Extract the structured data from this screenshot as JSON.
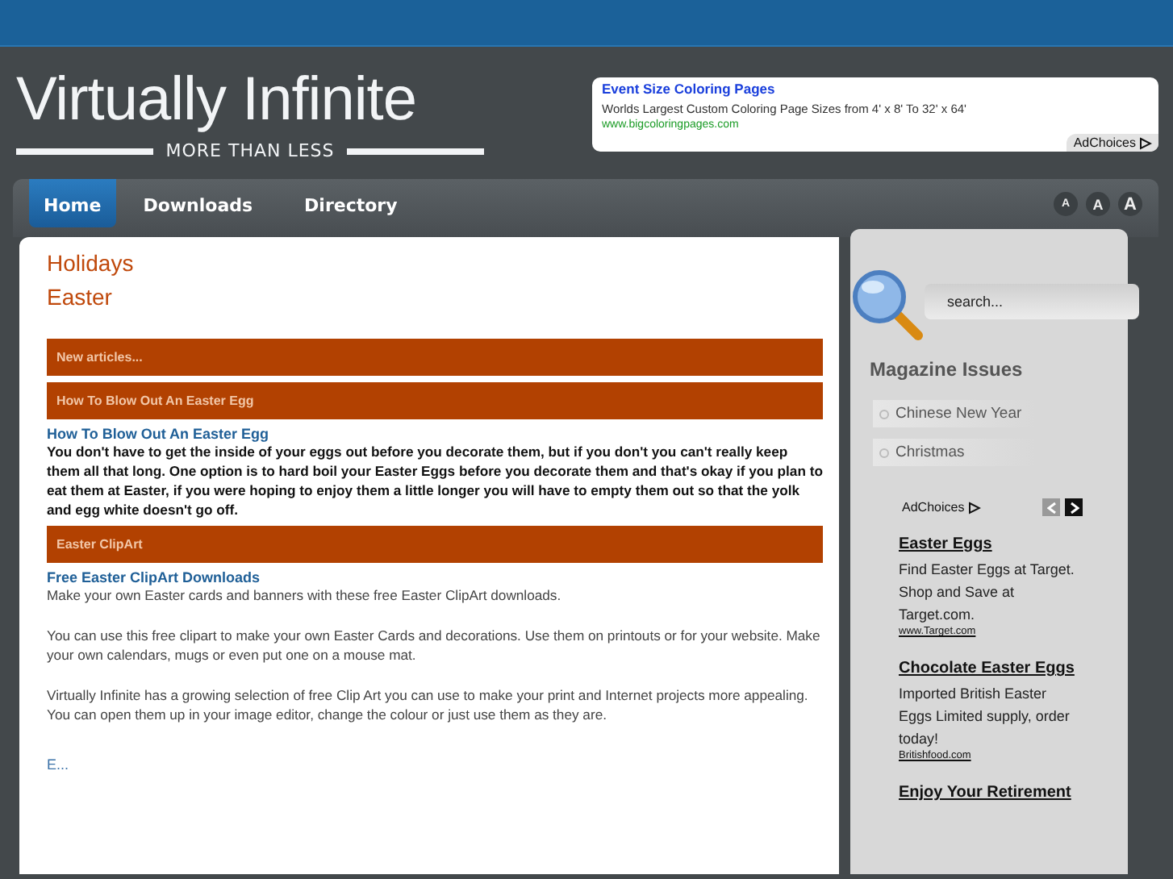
{
  "site": {
    "title": "Virtually Infinite",
    "tagline": "MORE THAN LESS"
  },
  "top_ad": {
    "title": "Event Size Coloring Pages",
    "text": "Worlds Largest Custom Coloring Page Sizes from 4' x 8' To 32' x 64'",
    "url": "www.bigcoloringpages.com",
    "adchoices": "AdChoices"
  },
  "nav": [
    {
      "label": "Home",
      "selected": true
    },
    {
      "label": "Downloads",
      "selected": false
    },
    {
      "label": "Directory",
      "selected": false
    }
  ],
  "font_sizes": [
    "A",
    "A",
    "A"
  ],
  "breadcrumbs": [
    "Holidays",
    "Easter"
  ],
  "sections": [
    {
      "heading": "New articles..."
    },
    {
      "heading": "How To Blow Out An Easter Egg",
      "items": [
        {
          "title": "How To Blow Out An Easter Egg",
          "bold": true,
          "paragraphs": [
            "You don't have to get the inside of your eggs out before you decorate them, but if you don't you can't really keep them all that long. One option is to hard boil your Easter Eggs before you decorate them and that's okay if you plan to eat them at Easter, if you were hoping to enjoy them a little longer you will have to empty them out so that the yolk and egg white doesn't go off."
          ]
        }
      ]
    },
    {
      "heading": "Easter ClipArt",
      "items": [
        {
          "title": "Free Easter ClipArt Downloads",
          "bold": false,
          "paragraphs": [
            "Make your own Easter cards and banners with these free Easter ClipArt downloads.",
            "You can use this free clipart to make your own Easter Cards and decorations. Use them on printouts or for your website. Make your own calendars, mugs or even put one on a mouse mat.",
            "Virtually Infinite has a growing selection of free Clip Art you can use to make your print and Internet projects more appealing. You can open them up in your image editor, change the colour or just use them as they are."
          ]
        }
      ]
    }
  ],
  "more_link": "E...",
  "sidebar": {
    "search": {
      "placeholder": "search..."
    },
    "heading": "Magazine Issues",
    "items": [
      "Chinese New Year",
      "Christmas"
    ],
    "ads": {
      "adchoices": "AdChoices",
      "entries": [
        {
          "title": "Easter Eggs",
          "text": "Find Easter Eggs at Target. Shop and Save at Target.com.",
          "url": "www.Target.com"
        },
        {
          "title": "Chocolate Easter Eggs",
          "text": "Imported British Easter Eggs Limited supply, order today!",
          "url": "Britishfood.com"
        },
        {
          "title": "Enjoy Your Retirement"
        }
      ]
    }
  }
}
